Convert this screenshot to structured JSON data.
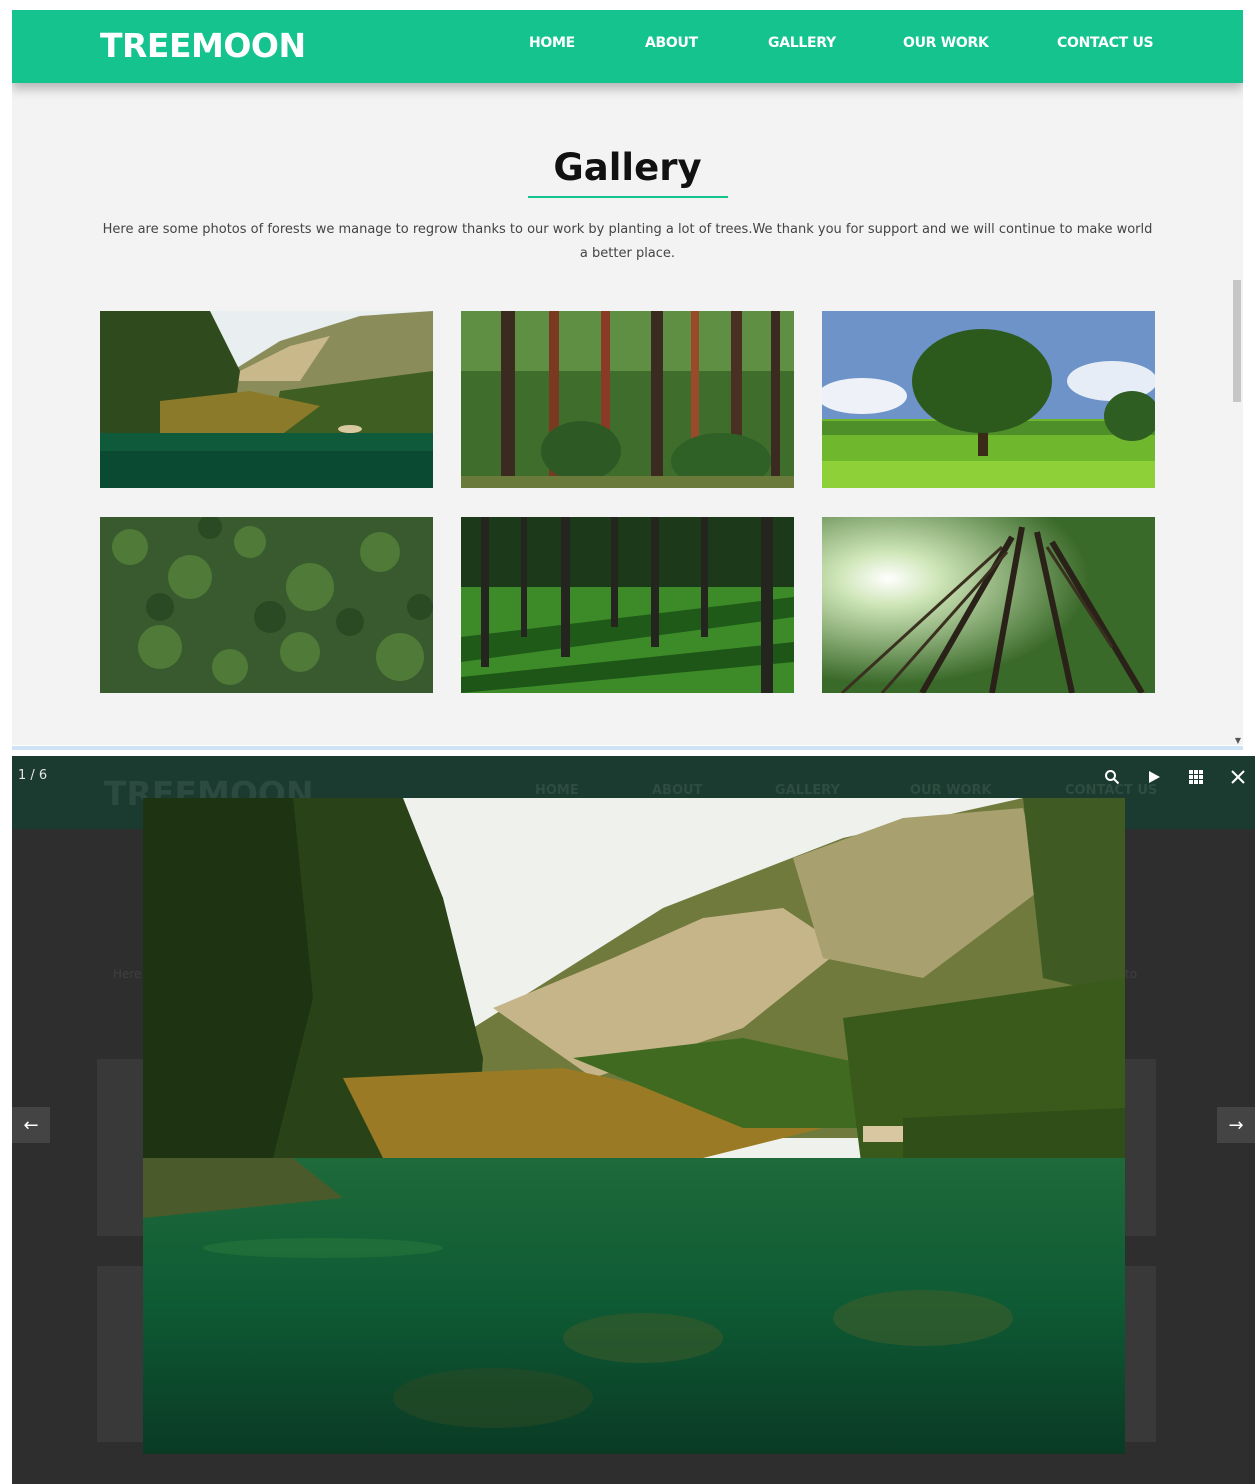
{
  "site": {
    "brand": "TREEMOON",
    "nav": [
      "HOME",
      "ABOUT",
      "GALLERY",
      "OUR WORK",
      "CONTACT US"
    ]
  },
  "gallery": {
    "title": "Gallery",
    "description": "Here are some photos of forests we manage to regrow thanks to our work by planting a lot of trees.We thank you for support and we will continue to make world a better place.",
    "images": [
      {
        "subject": "mountain lake with forest"
      },
      {
        "subject": "dense pine forest"
      },
      {
        "subject": "single tree on green meadow"
      },
      {
        "subject": "aerial view of forest canopy"
      },
      {
        "subject": "trees casting shadows on grass"
      },
      {
        "subject": "looking up at tall trees with sun"
      }
    ]
  },
  "lightbox": {
    "counter": "1 / 6",
    "tools": [
      "search-icon",
      "play-icon",
      "grid-icon",
      "close-icon"
    ],
    "prev_arrow": "←",
    "next_arrow": "→",
    "current_image": "mountain lake with forest",
    "bg_text_left": "Here",
    "bg_text_right": "to"
  },
  "colors": {
    "brand_green": "#14c38e",
    "page_bg": "#f3f3f3",
    "overlay_bg": "#2e2e2e"
  }
}
